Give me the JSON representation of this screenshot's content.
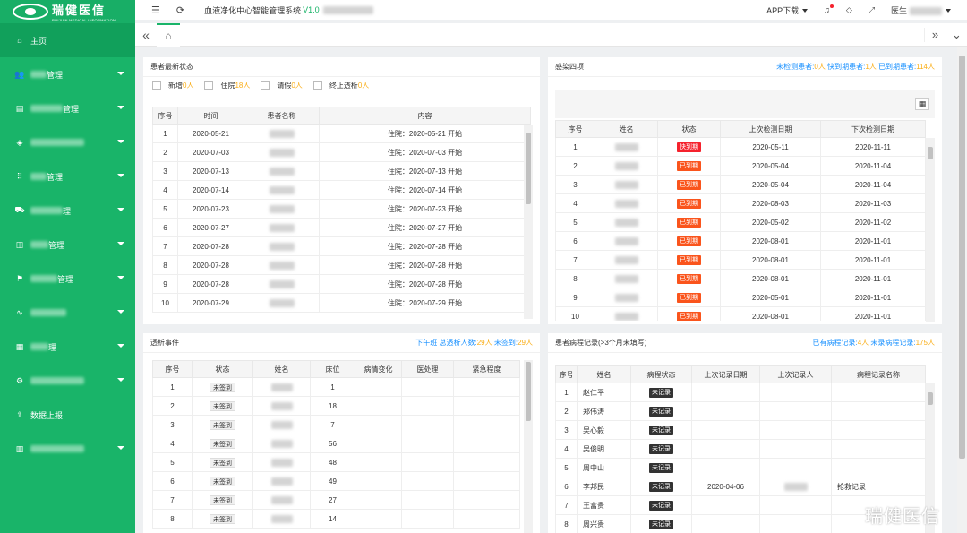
{
  "logo": {
    "cn": "瑞健医信",
    "en": "RUIJIAN MEDICAL INFORMATION"
  },
  "sidebar": {
    "items": [
      {
        "label": "主页",
        "icon": "home-icon",
        "active": true
      },
      {
        "label": "管理",
        "icon": "users-icon"
      },
      {
        "label": "管理",
        "icon": "document-icon"
      },
      {
        "label": "",
        "icon": "shield-icon"
      },
      {
        "label": "管理",
        "icon": "grid-icon"
      },
      {
        "label": "理",
        "icon": "car-icon"
      },
      {
        "label": "管理",
        "icon": "bag-icon"
      },
      {
        "label": "管理",
        "icon": "flag-icon"
      },
      {
        "label": "",
        "icon": "pulse-icon"
      },
      {
        "label": "理",
        "icon": "chart-icon"
      },
      {
        "label": "",
        "icon": "gear-icon"
      },
      {
        "label": "数据上报",
        "icon": "upload-icon"
      },
      {
        "label": "",
        "icon": "apps-icon"
      }
    ]
  },
  "topbar": {
    "title": "血液净化中心智能管理系统",
    "version": "V1.0",
    "app_download": "APP下载",
    "user": "医生"
  },
  "patient_status": {
    "title": "患者最新状态",
    "filters": [
      {
        "label": "新增",
        "count": "0人"
      },
      {
        "label": "住院",
        "count": "18人"
      },
      {
        "label": "请假",
        "count": "0人"
      },
      {
        "label": "终止透析",
        "count": "0人"
      }
    ],
    "headers": [
      "序号",
      "时间",
      "患者名称",
      "内容"
    ],
    "rows": [
      [
        "1",
        "2020-05-21",
        "住院：2020-05-21 开始"
      ],
      [
        "2",
        "2020-07-03",
        "住院：2020-07-03 开始"
      ],
      [
        "3",
        "2020-07-13",
        "住院：2020-07-13 开始"
      ],
      [
        "4",
        "2020-07-14",
        "住院：2020-07-14 开始"
      ],
      [
        "5",
        "2020-07-23",
        "住院：2020-07-23 开始"
      ],
      [
        "6",
        "2020-07-27",
        "住院：2020-07-27 开始"
      ],
      [
        "7",
        "2020-07-28",
        "住院：2020-07-28 开始"
      ],
      [
        "8",
        "2020-07-28",
        "住院：2020-07-28 开始"
      ],
      [
        "9",
        "2020-07-28",
        "住院：2020-07-28 开始"
      ],
      [
        "10",
        "2020-07-29",
        "住院：2020-07-29 开始"
      ]
    ]
  },
  "infection": {
    "title": "感染四项",
    "summary": {
      "l1": "未检测患者:",
      "v1": "0人",
      "l2": "快到期患者:",
      "v2": "1人",
      "l3": "已到期患者:",
      "v3": "114人"
    },
    "export_icon": "grid-export-icon",
    "headers": [
      "序号",
      "姓名",
      "状态",
      "上次检测日期",
      "下次检测日期"
    ],
    "rows": [
      [
        "1",
        "快到期",
        "2020-05-11",
        "2020-11-11"
      ],
      [
        "2",
        "已到期",
        "2020-05-04",
        "2020-11-04"
      ],
      [
        "3",
        "已到期",
        "2020-05-04",
        "2020-11-04"
      ],
      [
        "4",
        "已到期",
        "2020-08-03",
        "2020-11-03"
      ],
      [
        "5",
        "已到期",
        "2020-05-02",
        "2020-11-02"
      ],
      [
        "6",
        "已到期",
        "2020-08-01",
        "2020-11-01"
      ],
      [
        "7",
        "已到期",
        "2020-08-01",
        "2020-11-01"
      ],
      [
        "8",
        "已到期",
        "2020-08-01",
        "2020-11-01"
      ],
      [
        "9",
        "已到期",
        "2020-05-01",
        "2020-11-01"
      ],
      [
        "10",
        "已到期",
        "2020-08-01",
        "2020-11-01"
      ]
    ]
  },
  "dialysis": {
    "title": "透析事件",
    "summary": {
      "l1": "下午班 总透析人数:",
      "v1": "29人",
      "l2": "未签到:",
      "v2": "29人"
    },
    "headers": [
      "序号",
      "状态",
      "姓名",
      "床位",
      "病情变化",
      "医处理",
      "紧急程度"
    ],
    "rows": [
      [
        "1",
        "未签到",
        "1"
      ],
      [
        "2",
        "未签到",
        "18"
      ],
      [
        "3",
        "未签到",
        "7"
      ],
      [
        "4",
        "未签到",
        "56"
      ],
      [
        "5",
        "未签到",
        "48"
      ],
      [
        "6",
        "未签到",
        "49"
      ],
      [
        "7",
        "未签到",
        "27"
      ],
      [
        "8",
        "未签到",
        "14"
      ]
    ]
  },
  "records": {
    "title": "患者病程记录(>3个月未填写)",
    "summary": {
      "l1": "已有病程记录:",
      "v1": "4人",
      "l2": "未录病程记录:",
      "v2": "175人"
    },
    "headers": [
      "序号",
      "姓名",
      "病程状态",
      "上次记录日期",
      "上次记录人",
      "病程记录名称"
    ],
    "rows": [
      [
        "1",
        "赵仁平",
        "未记录",
        "",
        ""
      ],
      [
        "2",
        "郑伟涛",
        "未记录",
        "",
        ""
      ],
      [
        "3",
        "吴心毅",
        "未记录",
        "",
        ""
      ],
      [
        "4",
        "吴俊明",
        "未记录",
        "",
        ""
      ],
      [
        "5",
        "周中山",
        "未记录",
        "",
        ""
      ],
      [
        "6",
        "李邦民",
        "未记录",
        "2020-04-06",
        "抢救记录"
      ],
      [
        "7",
        "王富贵",
        "未记录",
        "",
        ""
      ],
      [
        "8",
        "周兴贵",
        "未记录",
        "",
        ""
      ]
    ]
  },
  "watermark": "瑞健医信"
}
